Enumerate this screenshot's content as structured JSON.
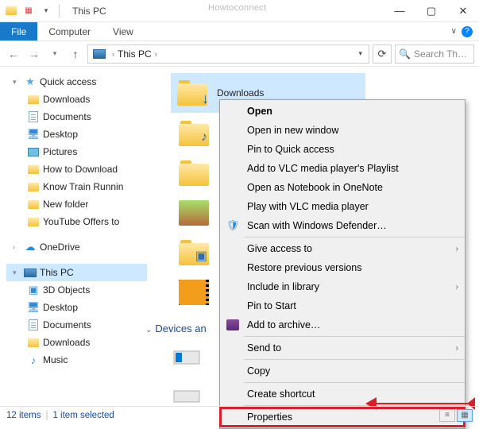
{
  "watermark": "Howtoconnect",
  "titlebar": {
    "title": "This PC"
  },
  "window_controls": {
    "min": "—",
    "max": "▢",
    "close": "✕"
  },
  "ribbon": {
    "file": "File",
    "tabs": [
      "Computer",
      "View"
    ],
    "help_chev": "∨",
    "help_q": "?"
  },
  "nav": {
    "back": "←",
    "fwd": "→",
    "hist": "▾",
    "up": "↑",
    "crumb_sep1": "›",
    "location": "This PC",
    "crumb_sep2": "›",
    "dd": "▾",
    "refresh": "⟳",
    "search_placeholder": "Search Th…"
  },
  "tree": {
    "quick_access": "Quick access",
    "items_qa": [
      "Downloads",
      "Documents",
      "Desktop",
      "Pictures",
      "How to Download",
      "Know Train Runnin",
      "New folder",
      "YouTube Offers to"
    ],
    "onedrive": "OneDrive",
    "this_pc": "This PC",
    "items_pc": [
      "3D Objects",
      "Desktop",
      "Documents",
      "Downloads",
      "Music"
    ]
  },
  "content": {
    "selected_folder": "Downloads",
    "section_devices": "Devices an"
  },
  "ctx": {
    "open": "Open",
    "open_new": "Open in new window",
    "pin_qa": "Pin to Quick access",
    "vlc_add": "Add to VLC media player's Playlist",
    "onenote": "Open as Notebook in OneNote",
    "vlc_play": "Play with VLC media player",
    "defender": "Scan with Windows Defender…",
    "give_access": "Give access to",
    "restore": "Restore previous versions",
    "include": "Include in library",
    "pin_start": "Pin to Start",
    "archive": "Add to archive…",
    "send_to": "Send to",
    "copy": "Copy",
    "shortcut": "Create shortcut",
    "properties": "Properties",
    "submenu_glyph": "›"
  },
  "status": {
    "count": "12 items",
    "selected": "1 item selected"
  }
}
